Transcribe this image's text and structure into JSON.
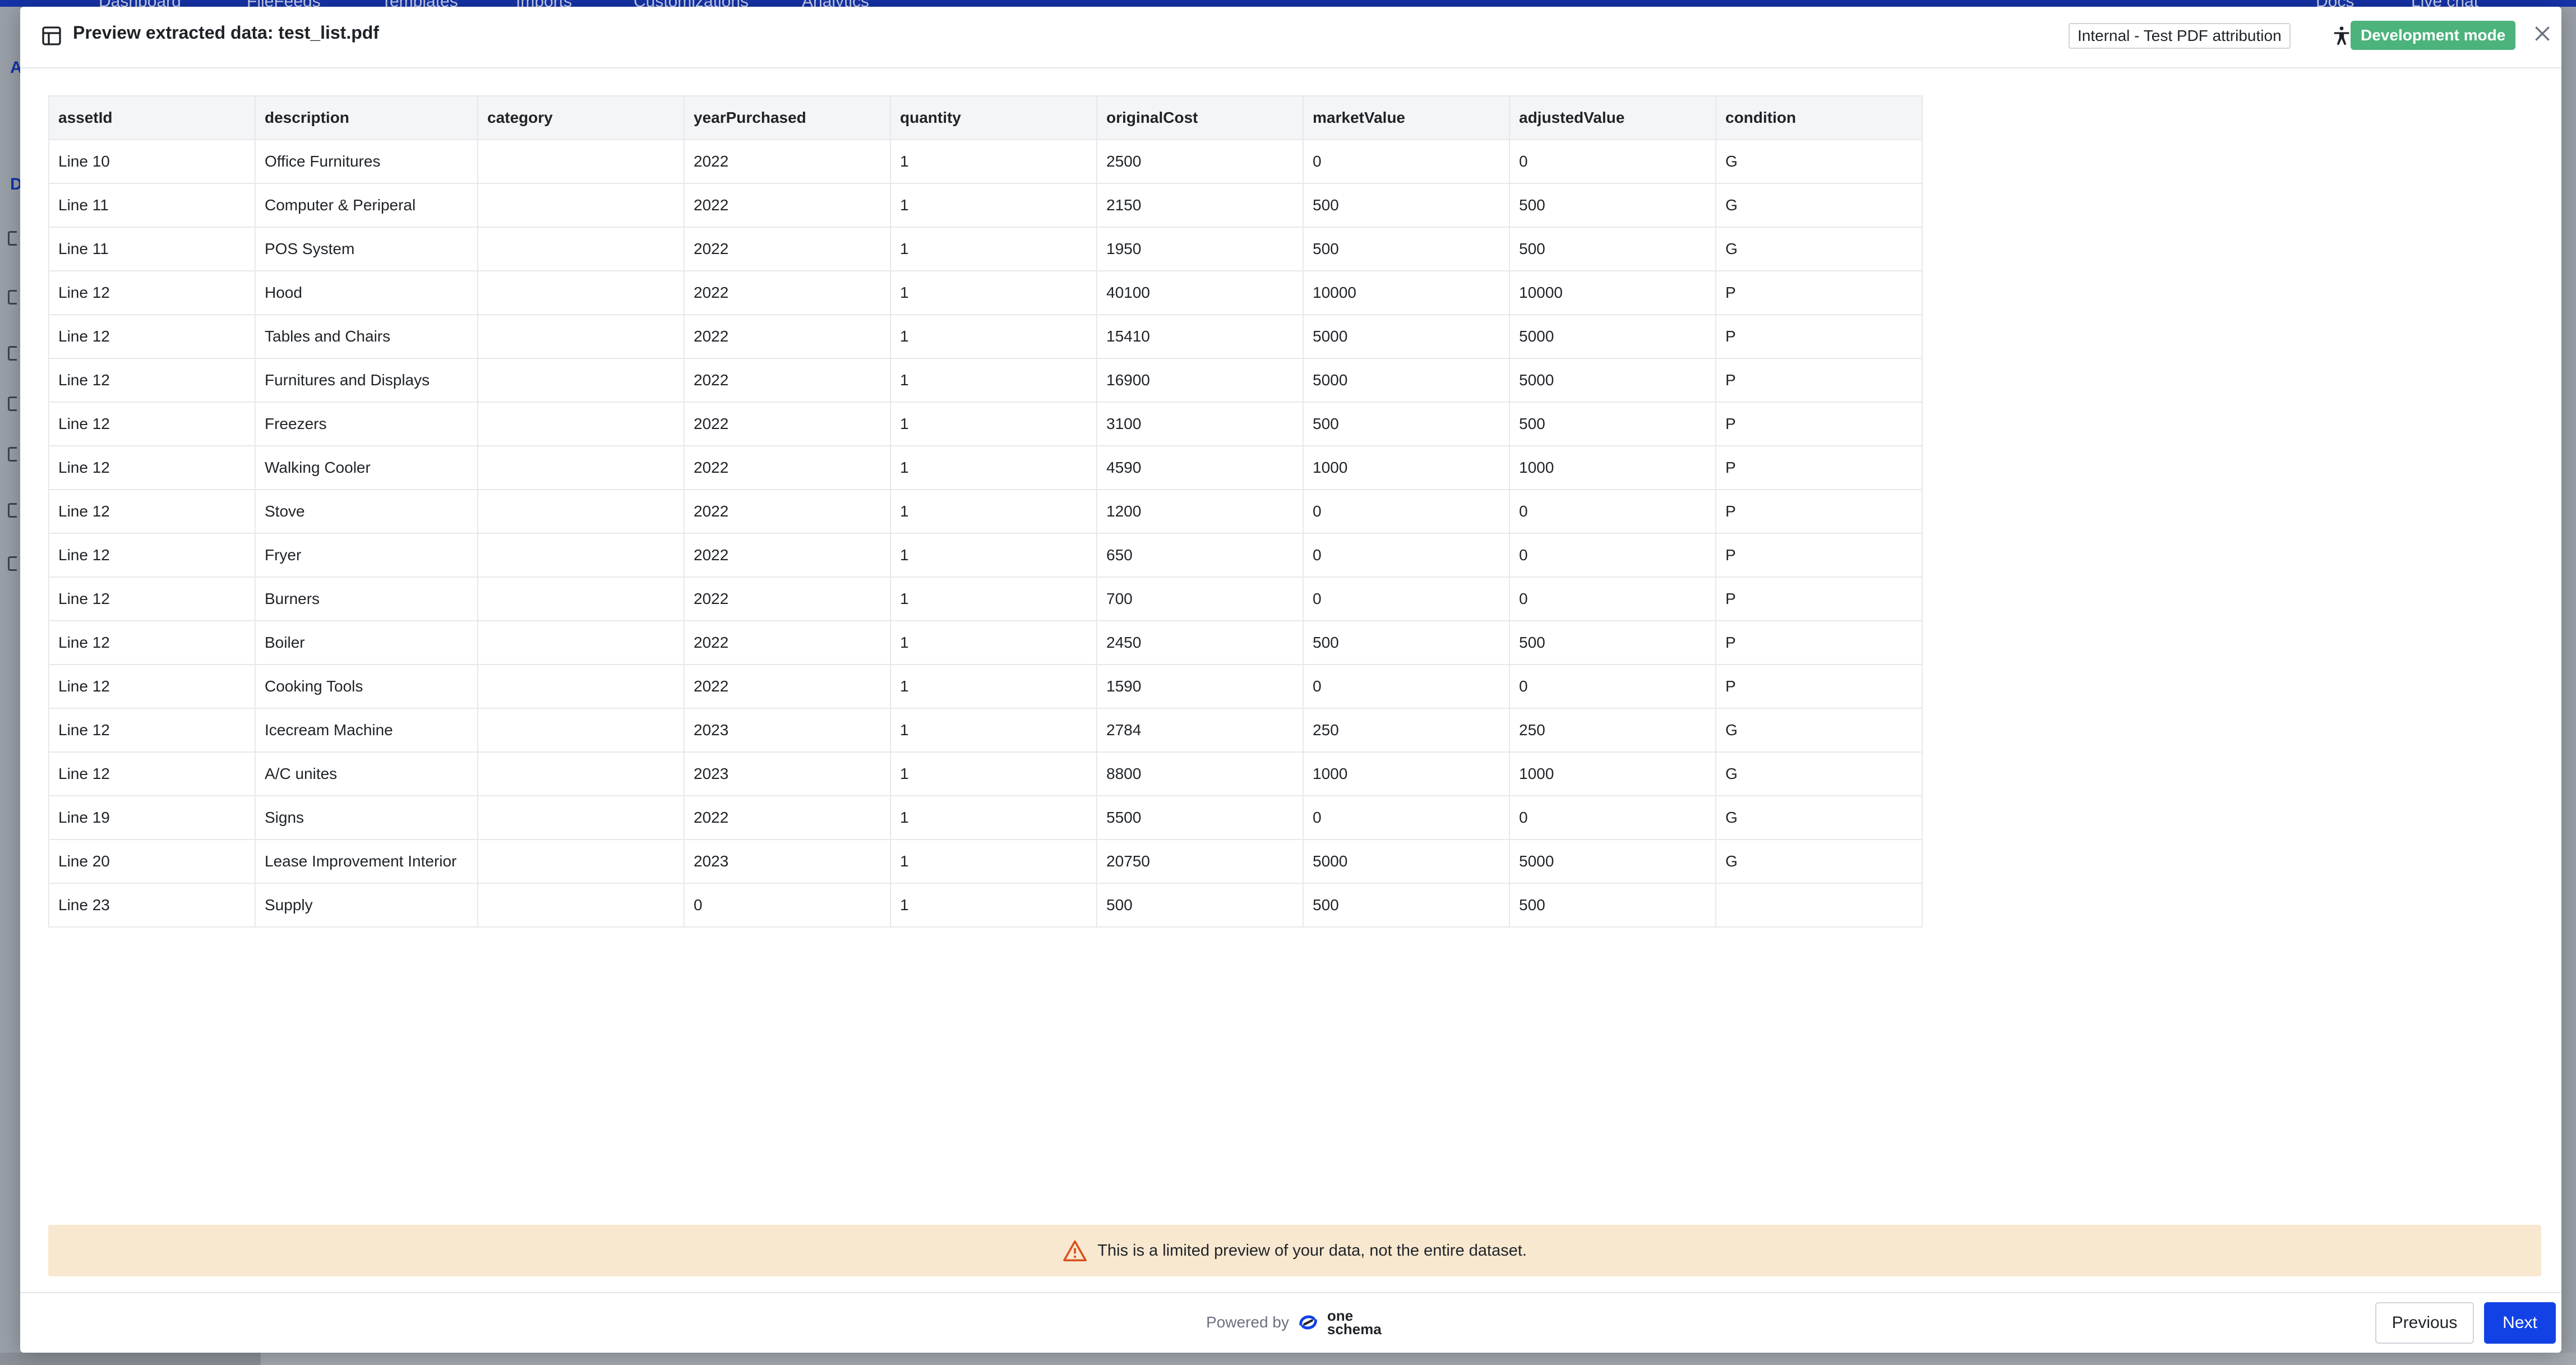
{
  "background_app": {
    "nav_items": [
      "Dashboard",
      "FileFeeds",
      "Templates",
      "Imports",
      "Customizations",
      "Analytics",
      "Docs",
      "Live chat"
    ],
    "sidebar_letters": [
      "A",
      "D"
    ]
  },
  "modal": {
    "title": "Preview extracted data: test_list.pdf",
    "tenant_badge": "Internal - Test PDF attribution",
    "dev_badge": "Development mode"
  },
  "table": {
    "columns": [
      "assetId",
      "description",
      "category",
      "yearPurchased",
      "quantity",
      "originalCost",
      "marketValue",
      "adjustedValue",
      "condition"
    ],
    "rows": [
      [
        "Line 10",
        "Office Furnitures",
        "",
        "2022",
        "1",
        "2500",
        "0",
        "0",
        "G"
      ],
      [
        "Line 11",
        "Computer & Periperal",
        "",
        "2022",
        "1",
        "2150",
        "500",
        "500",
        "G"
      ],
      [
        "Line 11",
        "POS System",
        "",
        "2022",
        "1",
        "1950",
        "500",
        "500",
        "G"
      ],
      [
        "Line 12",
        "Hood",
        "",
        "2022",
        "1",
        "40100",
        "10000",
        "10000",
        "P"
      ],
      [
        "Line 12",
        "Tables and Chairs",
        "",
        "2022",
        "1",
        "15410",
        "5000",
        "5000",
        "P"
      ],
      [
        "Line 12",
        "Furnitures and Displays",
        "",
        "2022",
        "1",
        "16900",
        "5000",
        "5000",
        "P"
      ],
      [
        "Line 12",
        "Freezers",
        "",
        "2022",
        "1",
        "3100",
        "500",
        "500",
        "P"
      ],
      [
        "Line 12",
        "Walking Cooler",
        "",
        "2022",
        "1",
        "4590",
        "1000",
        "1000",
        "P"
      ],
      [
        "Line 12",
        "Stove",
        "",
        "2022",
        "1",
        "1200",
        "0",
        "0",
        "P"
      ],
      [
        "Line 12",
        "Fryer",
        "",
        "2022",
        "1",
        "650",
        "0",
        "0",
        "P"
      ],
      [
        "Line 12",
        "Burners",
        "",
        "2022",
        "1",
        "700",
        "0",
        "0",
        "P"
      ],
      [
        "Line 12",
        "Boiler",
        "",
        "2022",
        "1",
        "2450",
        "500",
        "500",
        "P"
      ],
      [
        "Line 12",
        "Cooking Tools",
        "",
        "2022",
        "1",
        "1590",
        "0",
        "0",
        "P"
      ],
      [
        "Line 12",
        "Icecream Machine",
        "",
        "2023",
        "1",
        "2784",
        "250",
        "250",
        "G"
      ],
      [
        "Line 12",
        "A/C unites",
        "",
        "2023",
        "1",
        "8800",
        "1000",
        "1000",
        "G"
      ],
      [
        "Line 19",
        "Signs",
        "",
        "2022",
        "1",
        "5500",
        "0",
        "0",
        "G"
      ],
      [
        "Line 20",
        "Lease Improvement Interior",
        "",
        "2023",
        "1",
        "20750",
        "5000",
        "5000",
        "G"
      ],
      [
        "Line 23",
        "Supply",
        "",
        "0",
        "1",
        "500",
        "500",
        "500",
        ""
      ]
    ]
  },
  "notice": {
    "text": "This is a limited preview of your data, not the entire dataset.",
    "icon": "warning-icon"
  },
  "footer": {
    "powered_by": "Powered by",
    "logo_line1": "one",
    "logo_line2": "schema",
    "previous_label": "Previous",
    "next_label": "Next"
  },
  "colors": {
    "accent": "#1242e6",
    "dev_badge": "#4cb37c",
    "notice_bg": "#f8e8d0",
    "warning": "#d9531e"
  }
}
